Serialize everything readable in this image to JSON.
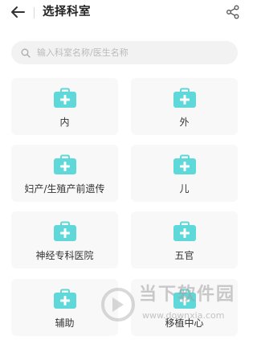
{
  "header": {
    "title": "选择科室",
    "back_icon": "arrow-left-icon",
    "share_icon": "share-icon"
  },
  "search": {
    "placeholder": "输入科室名称/医生名称",
    "icon": "search-icon"
  },
  "departments": [
    {
      "label": "内"
    },
    {
      "label": "外"
    },
    {
      "label": "妇产/生殖产前遗传"
    },
    {
      "label": "儿"
    },
    {
      "label": "神经专科医院"
    },
    {
      "label": "五官"
    },
    {
      "label": "辅助"
    },
    {
      "label": "移植中心"
    }
  ],
  "watermark": {
    "line1": "当下软件园",
    "line2": "www.downxia.com"
  },
  "colors": {
    "icon_accent": "#5ed8d8",
    "card_bg": "#f8f8f8",
    "search_bg": "#f2f2f2"
  }
}
